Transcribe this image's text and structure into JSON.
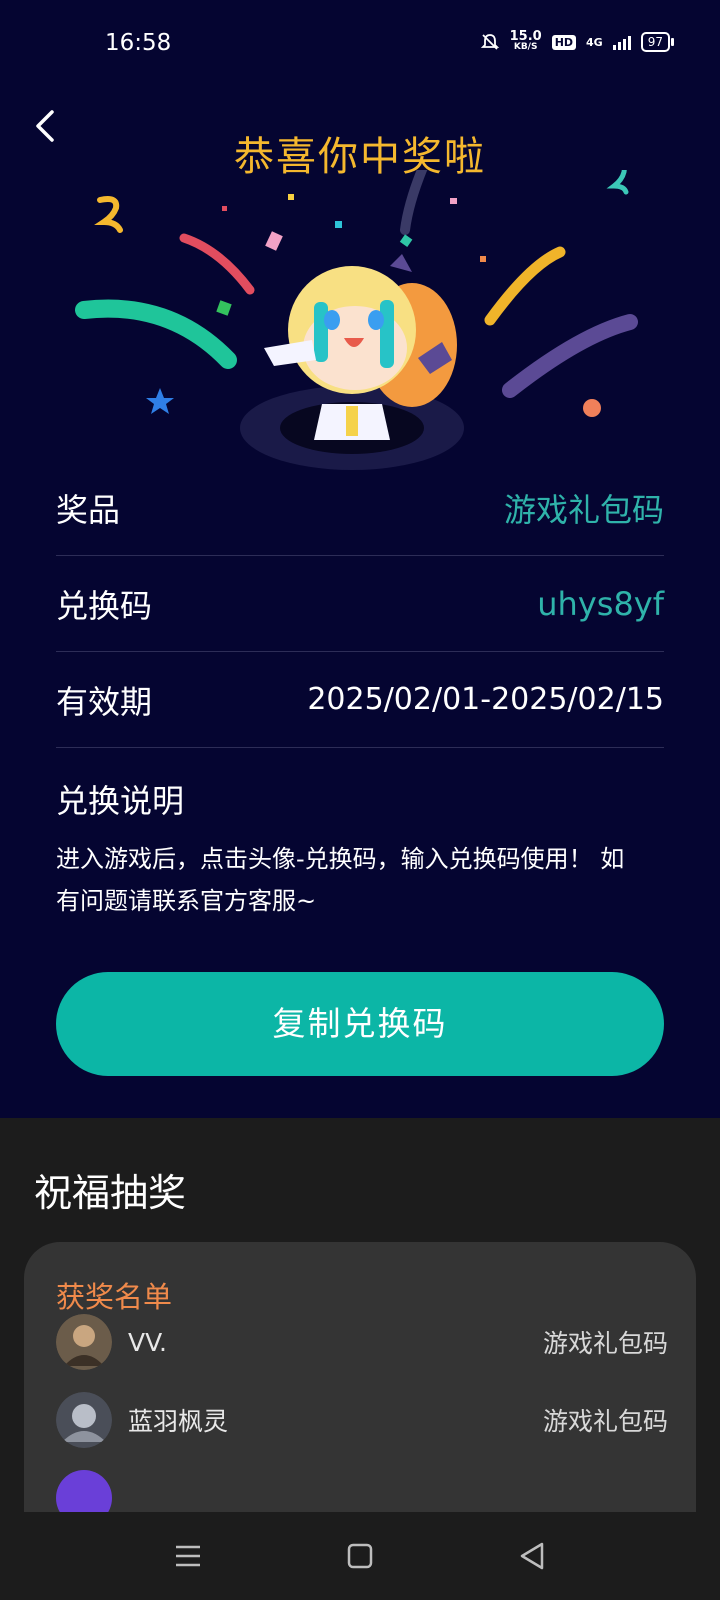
{
  "status_bar": {
    "time": "16:58",
    "speed_value": "15.0",
    "speed_unit": "KB/S",
    "hd": "HD",
    "network": "4G",
    "battery": "97"
  },
  "header": {
    "title": "恭喜你中奖啦"
  },
  "prize_info": {
    "prize_label": "奖品",
    "prize_value": "游戏礼包码",
    "code_label": "兑换码",
    "code_value": "uhys8yf",
    "validity_label": "有效期",
    "validity_value": "2025/02/01-2025/02/15",
    "instructions_label": "兑换说明",
    "instructions_text": "进入游戏后，点击头像-兑换码，输入兑换码使用！ 如有问题请联系官方客服~"
  },
  "copy_button": {
    "label": "复制兑换码"
  },
  "blessing": {
    "title": "祝福抽奖",
    "winners_label": "获奖名单",
    "winners": [
      {
        "name": "VV.",
        "prize": "游戏礼包码"
      },
      {
        "name": "蓝羽枫灵",
        "prize": "游戏礼包码"
      }
    ]
  },
  "colors": {
    "background_top": "#050531",
    "title": "#f5b82e",
    "accent_teal": "#0cb6a6",
    "code_text": "#2fb3aa",
    "winners_label": "#f08a4b",
    "card_bg": "#343434"
  },
  "icons": [
    "back-icon",
    "bell-mute-icon",
    "signal-icon",
    "battery-icon",
    "menu-icon",
    "home-icon",
    "back-nav-icon"
  ]
}
